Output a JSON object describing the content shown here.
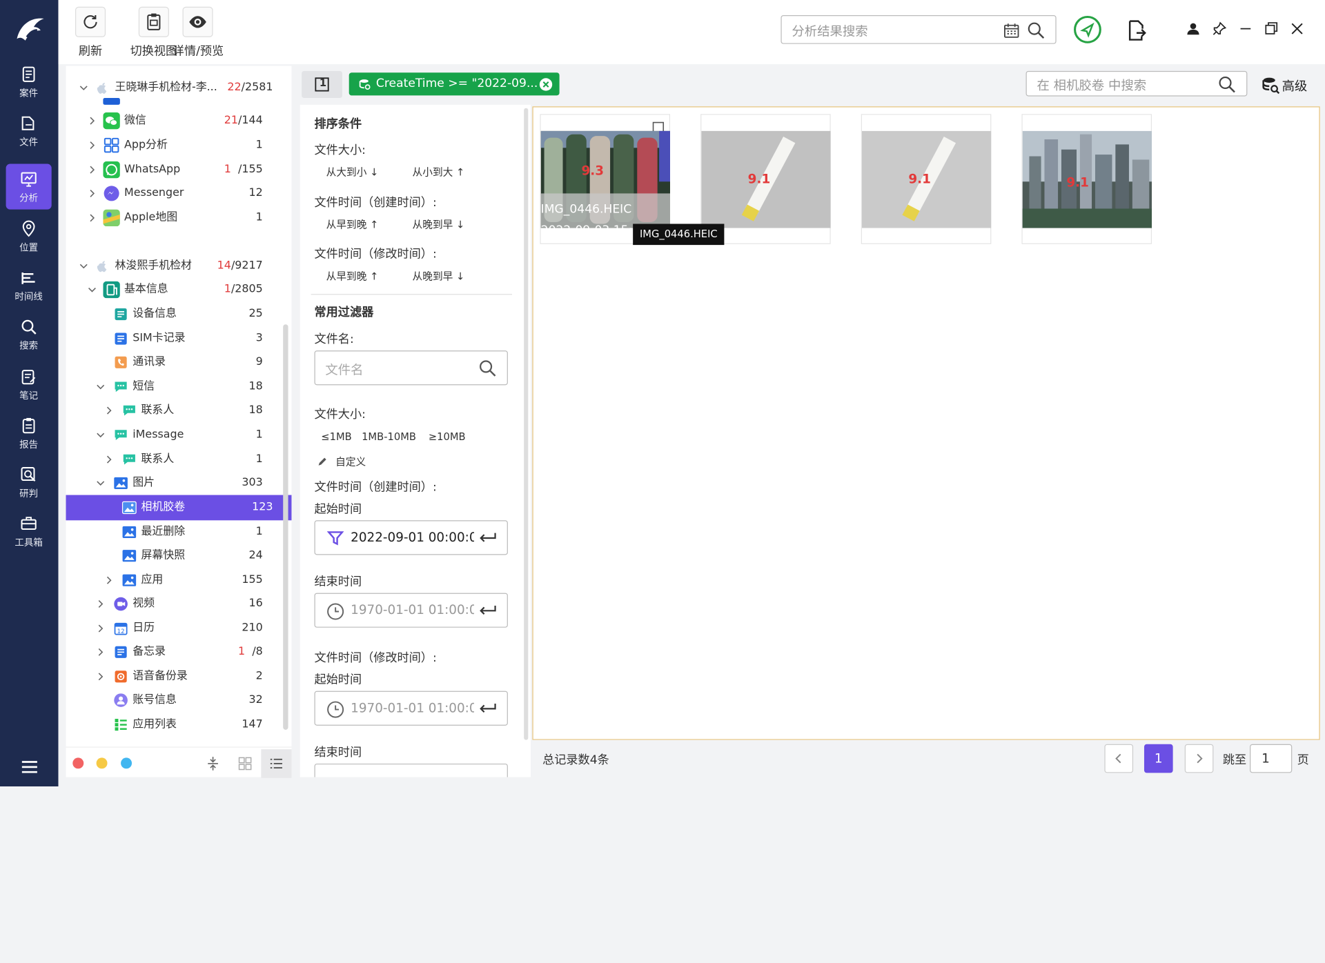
{
  "nav": {
    "items": [
      {
        "label": "案件",
        "icon": "case-icon"
      },
      {
        "label": "文件",
        "icon": "folder-icon"
      },
      {
        "label": "分析",
        "icon": "analysis-icon",
        "active": true
      },
      {
        "label": "位置",
        "icon": "location-icon"
      },
      {
        "label": "时间线",
        "icon": "timeline-icon"
      },
      {
        "label": "搜索",
        "icon": "search-icon"
      },
      {
        "label": "笔记",
        "icon": "note-icon"
      },
      {
        "label": "报告",
        "icon": "report-icon"
      },
      {
        "label": "研判",
        "icon": "judge-icon"
      },
      {
        "label": "工具箱",
        "icon": "toolbox-icon"
      }
    ]
  },
  "toolbar": {
    "refresh": "刷新",
    "switch_view": "切换视图",
    "detail_preview": "详情/预览",
    "search_placeholder": "分析结果搜索"
  },
  "tree": {
    "rows": [
      {
        "label": "王晓琳手机检材-李...",
        "count_red": "22",
        "count": "/2581"
      },
      {
        "label": "微信",
        "count_red": "21",
        "count": "/144"
      },
      {
        "label": "App分析",
        "count_red": "",
        "count": "1"
      },
      {
        "label": "WhatsApp",
        "count_red": "1",
        "count": "/155"
      },
      {
        "label": "Messenger",
        "count_red": "",
        "count": "12"
      },
      {
        "label": "Apple地图",
        "count_red": "",
        "count": "1"
      },
      {
        "label": "林浚熙手机检材",
        "count_red": "14",
        "count": "/9217"
      },
      {
        "label": "基本信息",
        "count_red": "1",
        "count": "/2805"
      },
      {
        "label": "设备信息",
        "count_red": "",
        "count": "25"
      },
      {
        "label": "SIM卡记录",
        "count_red": "",
        "count": "3"
      },
      {
        "label": "通讯录",
        "count_red": "",
        "count": "9"
      },
      {
        "label": "短信",
        "count_red": "",
        "count": "18"
      },
      {
        "label": "联系人",
        "count_red": "",
        "count": "18"
      },
      {
        "label": "iMessage",
        "count_red": "",
        "count": "1"
      },
      {
        "label": "联系人",
        "count_red": "",
        "count": "1"
      },
      {
        "label": "图片",
        "count_red": "",
        "count": "303"
      },
      {
        "label": "相机胶卷",
        "count_red": "",
        "count": "123"
      },
      {
        "label": "最近删除",
        "count_red": "",
        "count": "1"
      },
      {
        "label": "屏幕快照",
        "count_red": "",
        "count": "24"
      },
      {
        "label": "应用",
        "count_red": "",
        "count": "155"
      },
      {
        "label": "视频",
        "count_red": "",
        "count": "16"
      },
      {
        "label": "日历",
        "count_red": "",
        "count": "210"
      },
      {
        "label": "备忘录",
        "count_red": "1",
        "count": "/8"
      },
      {
        "label": "语音备份录",
        "count_red": "",
        "count": "2"
      },
      {
        "label": "账号信息",
        "count_red": "",
        "count": "32"
      },
      {
        "label": "应用列表",
        "count_red": "",
        "count": "147"
      }
    ]
  },
  "tabbar": {
    "tab_number": "1",
    "chip": "CreateTime >= \"2022-09...",
    "search_placeholder": "在 相机胶卷 中搜索",
    "advanced": "高级"
  },
  "filter": {
    "sort_title": "排序条件",
    "file_size": "文件大小:",
    "size_desc": "从大到小",
    "size_asc": "从小到大",
    "ctime_label": "文件时间（创建时间）:",
    "early_late": "从早到晚",
    "late_early": "从晚到早",
    "mtime_label": "文件时间（修改时间）:",
    "common_title": "常用过滤器",
    "filename_label": "文件名:",
    "filename_placeholder": "文件名",
    "size_label": "文件大小:",
    "size_opt1": "≤1MB",
    "size_opt2": "1MB-10MB",
    "size_opt3": "≥10MB",
    "custom": "自定义",
    "ctime_label2": "文件时间（创建时间）:",
    "start_time": "起始时间",
    "ctime_start_value": "2022-09-01 00:00:0",
    "end_time": "结束时间",
    "ctime_end_value": "1970-01-01 01:00:0",
    "mtime_label2": "文件时间（修改时间）:",
    "start_time2": "起始时间",
    "mtime_start_value": "1970-01-01 01:00:0",
    "end_time2": "结束时间"
  },
  "results": {
    "card1_name": "IMG_0446.HEIC",
    "card1_date": "2022-09-03 15:",
    "tooltip": "IMG_0446.HEIC",
    "thumb_labels": [
      "9.3",
      "9.1",
      "9.1",
      "9.1"
    ]
  },
  "pager": {
    "total": "总记录数4条",
    "page": "1",
    "goto": "跳至",
    "goto_value": "1",
    "page_unit": "页"
  }
}
